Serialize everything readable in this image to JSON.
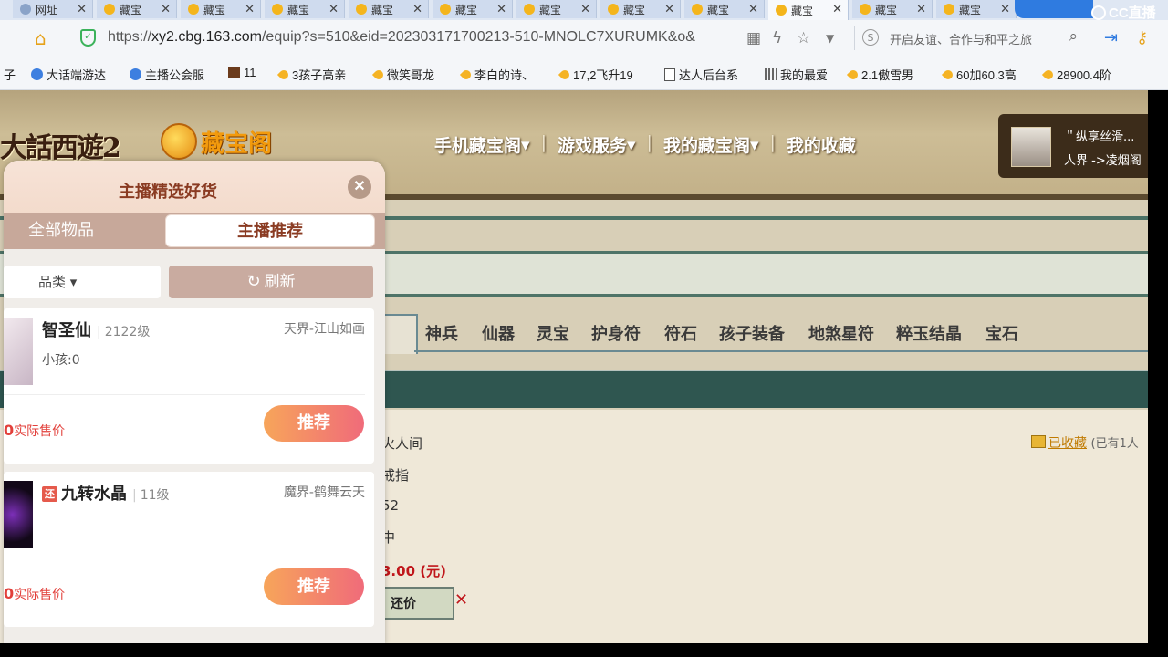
{
  "browser": {
    "tabs": [
      {
        "label": "网址",
        "icon": "globe-icon"
      },
      {
        "label": "藏宝",
        "icon": "game-icon"
      },
      {
        "label": "藏宝",
        "icon": "game-icon"
      },
      {
        "label": "藏宝",
        "icon": "game-icon"
      },
      {
        "label": "藏宝",
        "icon": "game-icon"
      },
      {
        "label": "藏宝",
        "icon": "game-icon"
      },
      {
        "label": "藏宝",
        "icon": "game-icon"
      },
      {
        "label": "藏宝",
        "icon": "game-icon"
      },
      {
        "label": "藏宝",
        "icon": "game-icon"
      },
      {
        "label": "藏宝",
        "icon": "game-icon"
      },
      {
        "label": "藏宝",
        "icon": "game-icon"
      },
      {
        "label": "藏宝",
        "icon": "game-icon"
      }
    ],
    "active_tab_index": 9,
    "url_prefix": "https://",
    "url_host": "xy2.cbg.163.com",
    "url_path": "/equip?s=510&eid=202303171700213-510-MNOLC7XURUMK&o&",
    "search_text": "开启友谊、合作与和平之旅",
    "overlay_brand": "CC直播",
    "bookmarks": [
      "子",
      "大话端游达",
      "主播公会服",
      "11",
      "3孩子高亲",
      "微笑哥龙",
      "李白的诗、",
      "17,2飞升19",
      "达人后台系",
      "我的最爱",
      "2.1傲雪男",
      "60加60.3高",
      "28900.4阶"
    ]
  },
  "site": {
    "game_logo": "大話西遊2",
    "cbg_logo": "藏宝阁",
    "nav": [
      {
        "label": "手机藏宝阁",
        "has_dropdown": true
      },
      {
        "label": "游戏服务",
        "has_dropdown": true
      },
      {
        "label": "我的藏宝阁",
        "has_dropdown": true
      },
      {
        "label": "我的收藏",
        "has_dropdown": false
      }
    ],
    "user": {
      "name": "＂纵享丝滑...",
      "realm": "人界 ->凌烟阁"
    },
    "categories": [
      "神兵",
      "仙器",
      "灵宝",
      "护身符",
      "符石",
      "孩子装备",
      "地煞星符",
      "粹玉结晶",
      "宝石"
    ],
    "detail_lines": [
      "火人间",
      "戒指",
      "52",
      "中"
    ],
    "detail_price": "3.00 (元)",
    "counter_offer": "还价",
    "favorite": {
      "link": "已收藏",
      "count_text": "(已有1人"
    }
  },
  "panel": {
    "title": "主播精选好货",
    "tabs": [
      "全部物品",
      "主播推荐"
    ],
    "active_tab": "主播推荐",
    "filter_label": "品类",
    "refresh_label": "刷新",
    "items": [
      {
        "name": "智圣仙",
        "level": "2122级",
        "server": "天界-江山如画",
        "sub": "小孩:0",
        "price_value": "0",
        "price_label": "实际售价",
        "button": "推荐",
        "tag": ""
      },
      {
        "name": "九转水晶",
        "level": "11级",
        "server": "魔界-鹤舞云天",
        "sub": "",
        "price_value": "0",
        "price_label": "实际售价",
        "button": "推荐",
        "tag": "还"
      }
    ]
  },
  "colors": {
    "accent": "#8a3b22",
    "price": "#e2403b",
    "button_from": "#f7a55a",
    "button_to": "#f06b7a",
    "cbg_green": "#2f5650"
  }
}
